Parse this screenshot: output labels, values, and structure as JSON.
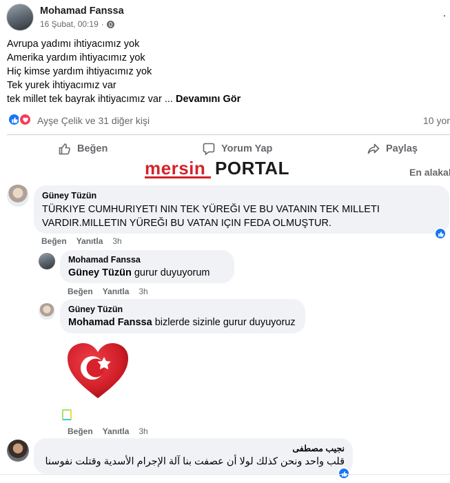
{
  "post": {
    "author": "Mohamad Fanssa",
    "date": "16 Şubat, 00:19",
    "date_separator": "·",
    "more_icon": "more-dots-icon",
    "lines": [
      "Avrupa yadımı ihtiyacımız yok",
      "Amerika yardım ihtiyacımız yok",
      "Hiç kimse yardım ihtiyacımız yok",
      "Tek yurek ihtiyacımız var"
    ],
    "last_line": "tek millet tek bayrak ihtiyacımız var ... ",
    "see_more": "Devamını Gör",
    "reactions_text": "Ayşe Çelik ve 31 diğer kişi",
    "comments_count": "10 yor"
  },
  "actions": {
    "like": "Beğen",
    "comment": "Yorum Yap",
    "share": "Paylaş"
  },
  "watermark": {
    "mersin": "mersin",
    "portal": "PORTAL",
    "brand_color": "#d2232a"
  },
  "sort_label": "En alakal",
  "comments": [
    {
      "author": "Güney Tüzün",
      "text": "TÜRKIYE CUMHURIYETI NIN TEK YÜREĞI VE BU VATANIN TEK MILLETI VARDIR.MILLETIN YÜREĞI BU VATAN IÇIN FEDA OLMUŞTUR.",
      "like": "Beğen",
      "reply": "Yanıtla",
      "time": "3h"
    },
    {
      "author": "Mohamad Fanssa",
      "mention": "Güney Tüzün",
      "text": " gurur duyuyorum",
      "like": "Beğen",
      "reply": "Yanıtla",
      "time": "3h"
    },
    {
      "author": "Güney Tüzün",
      "mention": "Mohamad Fanssa",
      "text": " bizlerde sizinle gurur duyuyoruz",
      "like": "Beğen",
      "reply": "Yanıtla",
      "time": "3h"
    },
    {
      "author": "نجيب مصطفى",
      "text": "قلب واحد ونحن كذلك لولا أن عصفت بنا آلة الإجرام الأسدية وقتلت نفوسنا"
    }
  ],
  "colors": {
    "facebook_blue": "#1877f2",
    "love_red": "#f33e58",
    "bubble_bg": "#f0f2f5",
    "secondary_text": "#65676b"
  }
}
